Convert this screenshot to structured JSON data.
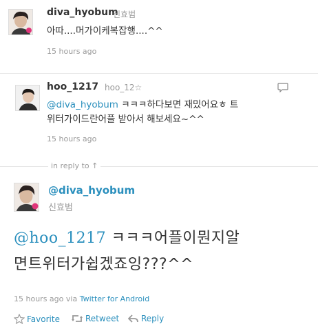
{
  "tweet1": {
    "username": "diva_hyobum",
    "realname": "신효범",
    "text": "아따....머가이케복잡행....^^",
    "time": "15 hours ago",
    "avatar_icon": "person-portrait-icon"
  },
  "tweet2": {
    "username": "hoo_1217",
    "realname": "hoo_12☆",
    "mention": "@diva_hyobum",
    "text_line1": " ㅋㅋㅋ하다보면 재밌어요ㅎ 트",
    "text_line2": "위터가이드란어플 받아서 해보세요~^^",
    "time": "15 hours ago",
    "avatar_icon": "person-portrait-icon",
    "reply_icon": "speech-bubble-icon"
  },
  "in_reply": {
    "label": "in reply to ↑"
  },
  "main_tweet": {
    "username": "@diva_hyobum",
    "realname": "신효범",
    "mention": "@hoo_1217",
    "text_line1": " ㅋㅋㅋ어플이뭔지알",
    "text_line2": "면트위터가쉽겠죠잉???^^",
    "time": "15 hours ago",
    "via_prefix": "via",
    "via_source": "Twitter for Android",
    "actions": {
      "favorite": "Favorite",
      "retweet": "Retweet",
      "reply": "Reply"
    },
    "icons": {
      "favorite": "star-icon",
      "retweet": "retweet-icon",
      "reply": "reply-arrow-icon"
    }
  },
  "colors": {
    "link": "#2a8fbd",
    "muted": "#999999",
    "text": "#333333"
  }
}
